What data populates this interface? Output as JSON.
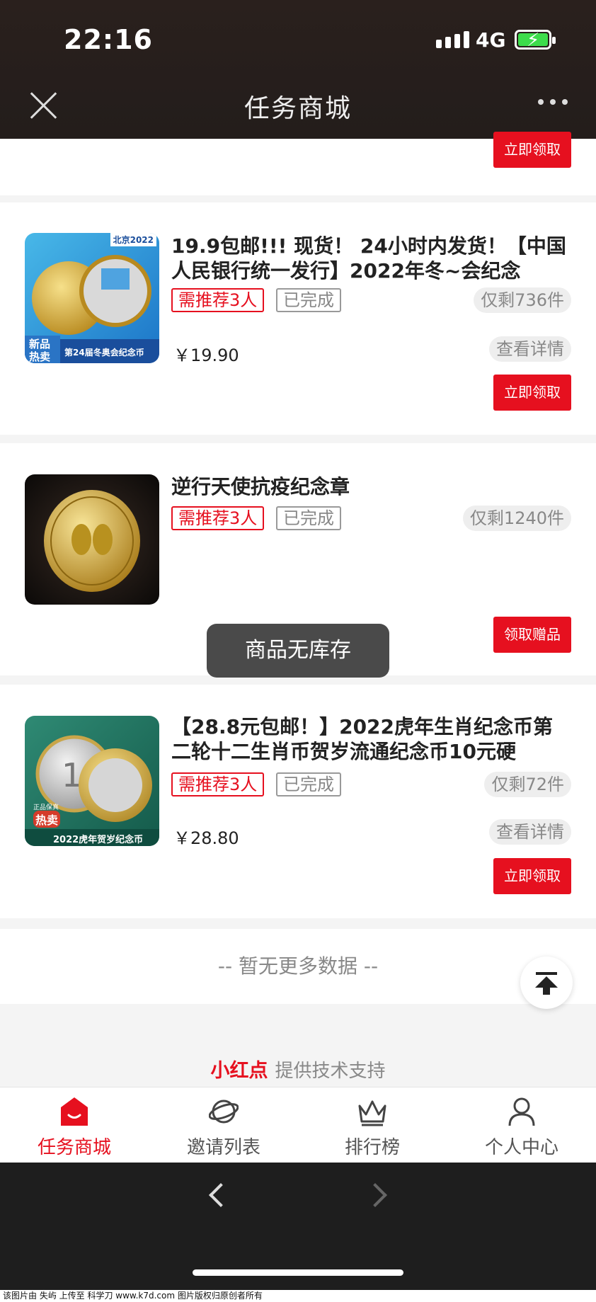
{
  "status": {
    "time": "22:16",
    "network": "4G"
  },
  "header": {
    "title": "任务商城"
  },
  "top_card": {
    "button": "立即领取"
  },
  "products": [
    {
      "title": "19.9包邮!!! 现货！ 24小时内发货！【中国人民银行统一发行】2022年冬~会纪念",
      "tag_required": "需推荐3人",
      "tag_status": "已完成",
      "stock": "仅剩736件",
      "price": "￥19.90",
      "detail": "查看详情",
      "button": "立即领取",
      "thumb_texts": [
        "北京2022",
        "新品",
        "热卖",
        "第24届冬奥会纪念币"
      ]
    },
    {
      "title": "逆行天使抗疫纪念章",
      "tag_required": "需推荐3人",
      "tag_status": "已完成",
      "stock": "仅剩1240件",
      "button": "领取赠品"
    },
    {
      "title": "【28.8元包邮！】2022虎年生肖纪念币第二轮十二生肖币贺岁流通纪念币10元硬",
      "tag_required": "需推荐3人",
      "tag_status": "已完成",
      "stock": "仅剩72件",
      "price": "￥28.80",
      "detail": "查看详情",
      "button": "立即领取",
      "thumb_texts": [
        "正品保真",
        "热卖",
        "2022虎年贺岁纪念币"
      ]
    }
  ],
  "toast": "商品无库存",
  "list_end": "-- 暂无更多数据 --",
  "support": {
    "brand": "小红点",
    "text": "提供技术支持"
  },
  "tabs": [
    {
      "label": "任务商城",
      "icon": "shop-icon",
      "active": true
    },
    {
      "label": "邀请列表",
      "icon": "planet-icon",
      "active": false
    },
    {
      "label": "排行榜",
      "icon": "crown-icon",
      "active": false
    },
    {
      "label": "个人中心",
      "icon": "user-icon",
      "active": false
    }
  ],
  "watermark": "该图片由 失屿 上传至 科学刀 www.k7d.com 图片版权归原创者所有",
  "colors": {
    "accent": "#e6101f",
    "header_bg": "#231d1b"
  }
}
